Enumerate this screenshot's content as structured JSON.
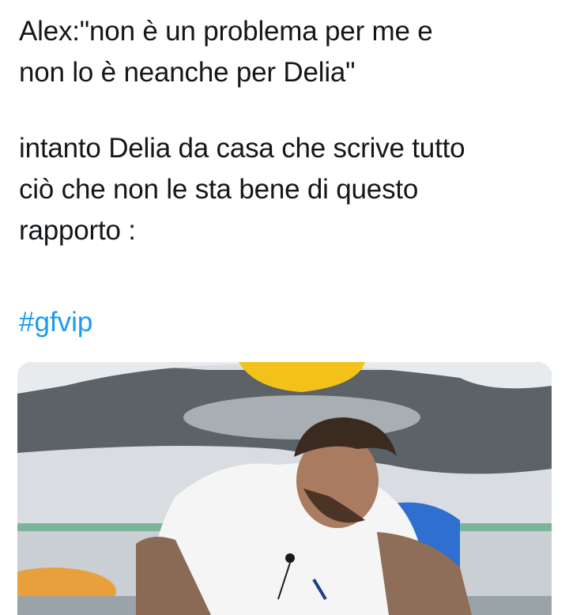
{
  "tweet": {
    "lines_1": [
      "Alex:\"non è un problema per me e",
      "non lo è neanche per Delia\""
    ],
    "lines_2": [
      "intanto Delia da casa che scrive tutto",
      "ciò che non le sta bene di questo",
      "rapporto :"
    ],
    "hashtag": "#gfvip"
  },
  "colors": {
    "text": "#14171a",
    "link": "#1d9bf0"
  }
}
